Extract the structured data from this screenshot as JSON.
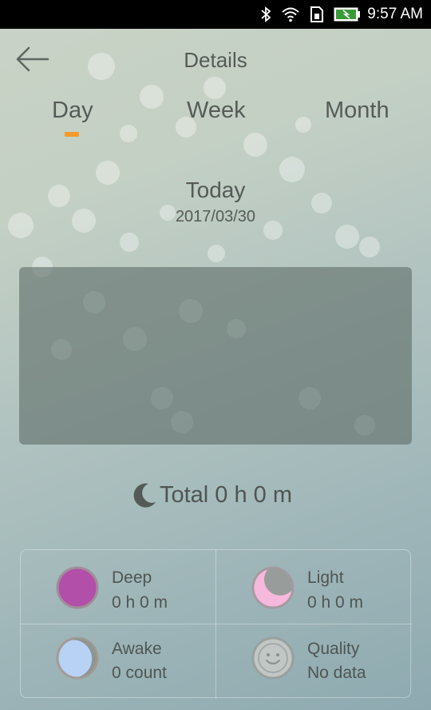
{
  "status_bar": {
    "time": "9:57 AM",
    "icons": [
      "bluetooth-icon",
      "wifi-icon",
      "sim-icon",
      "battery-charging-icon"
    ]
  },
  "header": {
    "back_icon": "arrow-left-icon",
    "title": "Details"
  },
  "tabs": [
    {
      "label": "Day",
      "selected": true
    },
    {
      "label": "Week",
      "selected": false
    },
    {
      "label": "Month",
      "selected": false
    }
  ],
  "date": {
    "label": "Today",
    "value": "2017/03/30"
  },
  "total": {
    "icon": "crescent-moon-icon",
    "text": "Total 0 h 0 m"
  },
  "stats": [
    {
      "icon": "deep-sleep-icon",
      "label": "Deep",
      "value": "0 h 0 m",
      "color": "#b04fa8"
    },
    {
      "icon": "light-sleep-icon",
      "label": "Light",
      "value": "0 h 0 m",
      "color": "#f6b8dc"
    },
    {
      "icon": "awake-icon",
      "label": "Awake",
      "value": "0 count",
      "color": "#b7d2f5"
    },
    {
      "icon": "smiley-icon",
      "label": "Quality",
      "value": "No data",
      "color": "#bfc6c4"
    }
  ],
  "colors": {
    "accent": "#f39b2a",
    "status_bar": "#000000",
    "chart_panel": "#5f6e69"
  }
}
